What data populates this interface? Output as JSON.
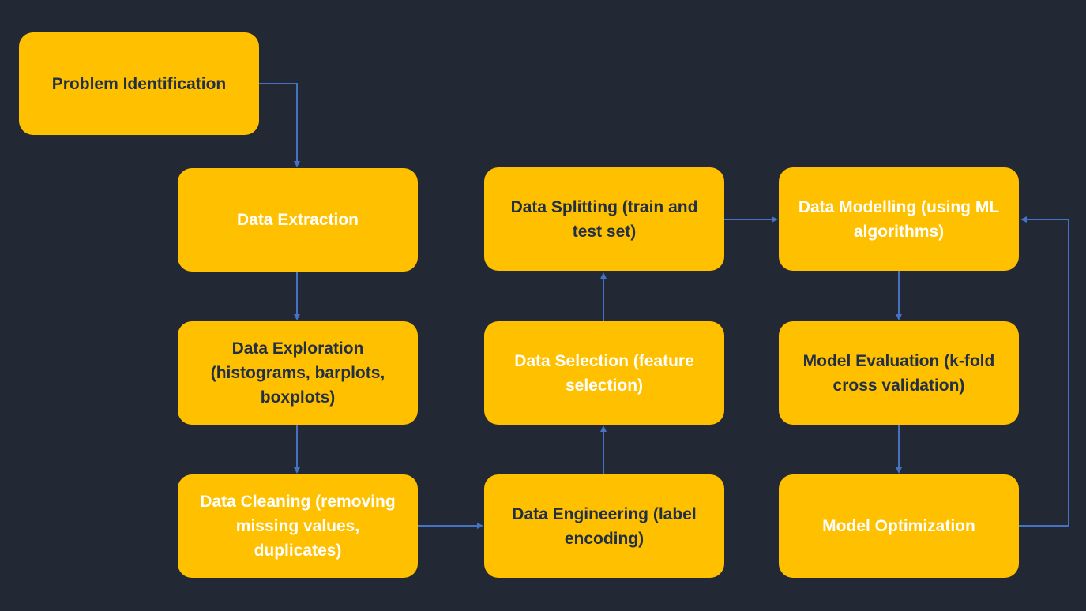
{
  "colors": {
    "background": "#222834",
    "node_fill": "#FFC000",
    "connector": "#4472C4",
    "dark_text": "#233044",
    "light_text": "#FFFFFF"
  },
  "nodes": {
    "problem_identification": "Problem Identification",
    "data_extraction": "Data Extraction",
    "data_exploration": "Data Exploration (histograms, barplots, boxplots)",
    "data_cleaning": "Data Cleaning (removing missing values, duplicates)",
    "data_engineering": "Data Engineering (label encoding)",
    "data_selection": "Data Selection (feature selection)",
    "data_splitting": "Data Splitting (train and test set)",
    "data_modelling": "Data Modelling (using ML algorithms)",
    "model_evaluation": "Model Evaluation (k-fold cross validation)",
    "model_optimization": "Model Optimization"
  }
}
